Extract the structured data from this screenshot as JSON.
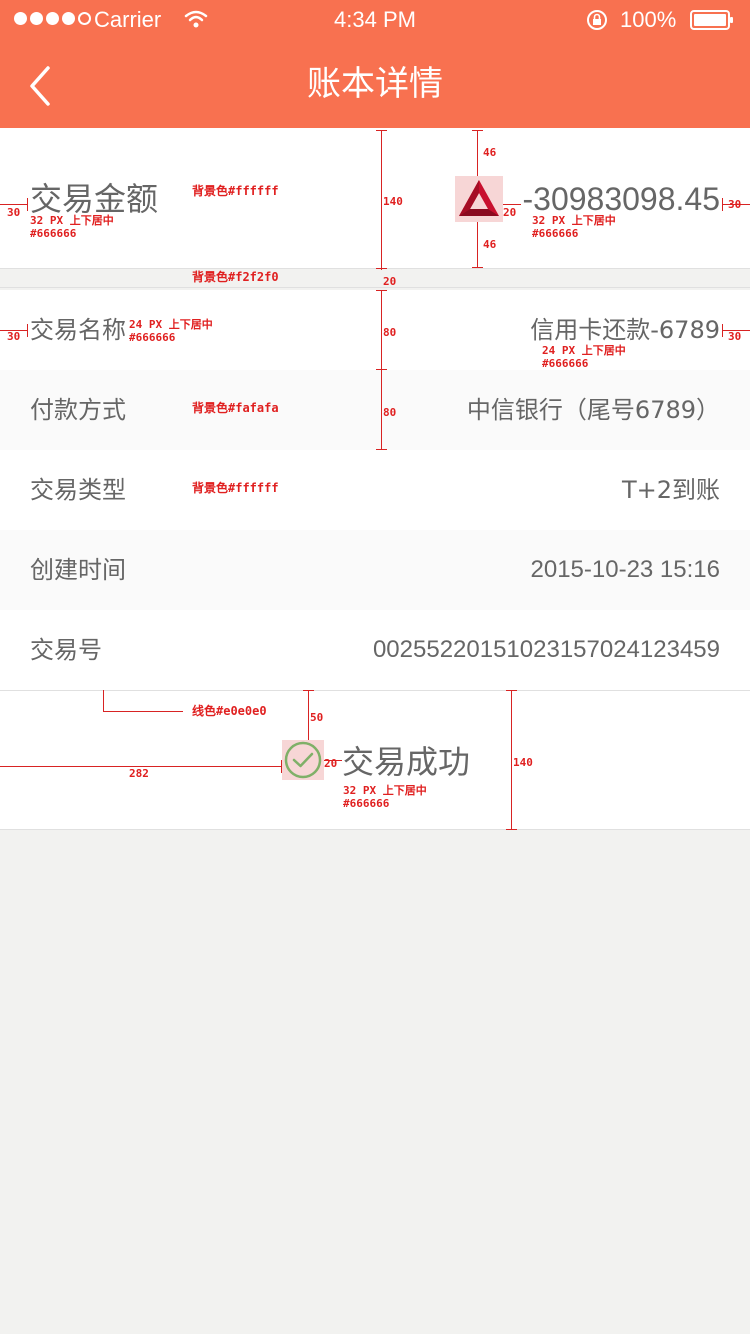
{
  "status_bar": {
    "carrier": "Carrier",
    "time": "4:34 PM",
    "battery": "100%",
    "icons": [
      "signal-dots-icon",
      "wifi-icon",
      "rotation-lock-icon",
      "battery-icon"
    ]
  },
  "nav": {
    "title": "账本详情",
    "back_icon": "chevron-left-icon"
  },
  "amount": {
    "label": "交易金额",
    "value": "-30983098.45",
    "bank_icon": "citic-bank-logo-icon"
  },
  "rows": [
    {
      "label": "交易名称",
      "value": "信用卡还款-6789"
    },
    {
      "label": "付款方式",
      "value": "中信银行（尾号6789）"
    },
    {
      "label": "交易类型",
      "value": "T+2到账"
    },
    {
      "label": "创建时间",
      "value": "2015-10-23 15:16"
    },
    {
      "label": "交易号",
      "value": "00255220151023157024123459"
    }
  ],
  "result": {
    "text": "交易成功",
    "icon": "check-circle-icon"
  },
  "annotations": {
    "a30_left": "30",
    "bg_white_1": "背景色#ffffff",
    "spec_label_1": "32 PX 上下居中",
    "spec_color_1": "#666666",
    "h140_1": "140",
    "top46": "46",
    "bottom46": "46",
    "gap20_icon": "20",
    "spec_label_2": "32 PX 上下居中",
    "spec_color_2": "#666666",
    "a30_right": "30",
    "bg_gray": "背景色#f2f2f0",
    "h20": "20",
    "a30_left_2": "30",
    "spec_label_3": "24 PX 上下居中",
    "spec_color_3": "#666666",
    "h80_1": "80",
    "spec_label_4": "24 PX 上下居中",
    "spec_color_4": "#666666",
    "a30_right_2": "30",
    "bg_fafafa": "背景色#fafafa",
    "h80_2": "80",
    "bg_white_2": "背景色#ffffff",
    "line_color": "线色#e0e0e0",
    "h50": "50",
    "w282": "282",
    "gap20_check": "20",
    "spec_label_5": "32 PX 上下居中",
    "spec_color_5": "#666666",
    "h140_2": "140"
  },
  "colors": {
    "header": "#f87150",
    "text": "#666666",
    "row_alt": "#fafafa",
    "page_bg": "#f2f2f0",
    "line": "#e0e0e0",
    "check": "#7fb068",
    "annotation": "#e02020"
  }
}
